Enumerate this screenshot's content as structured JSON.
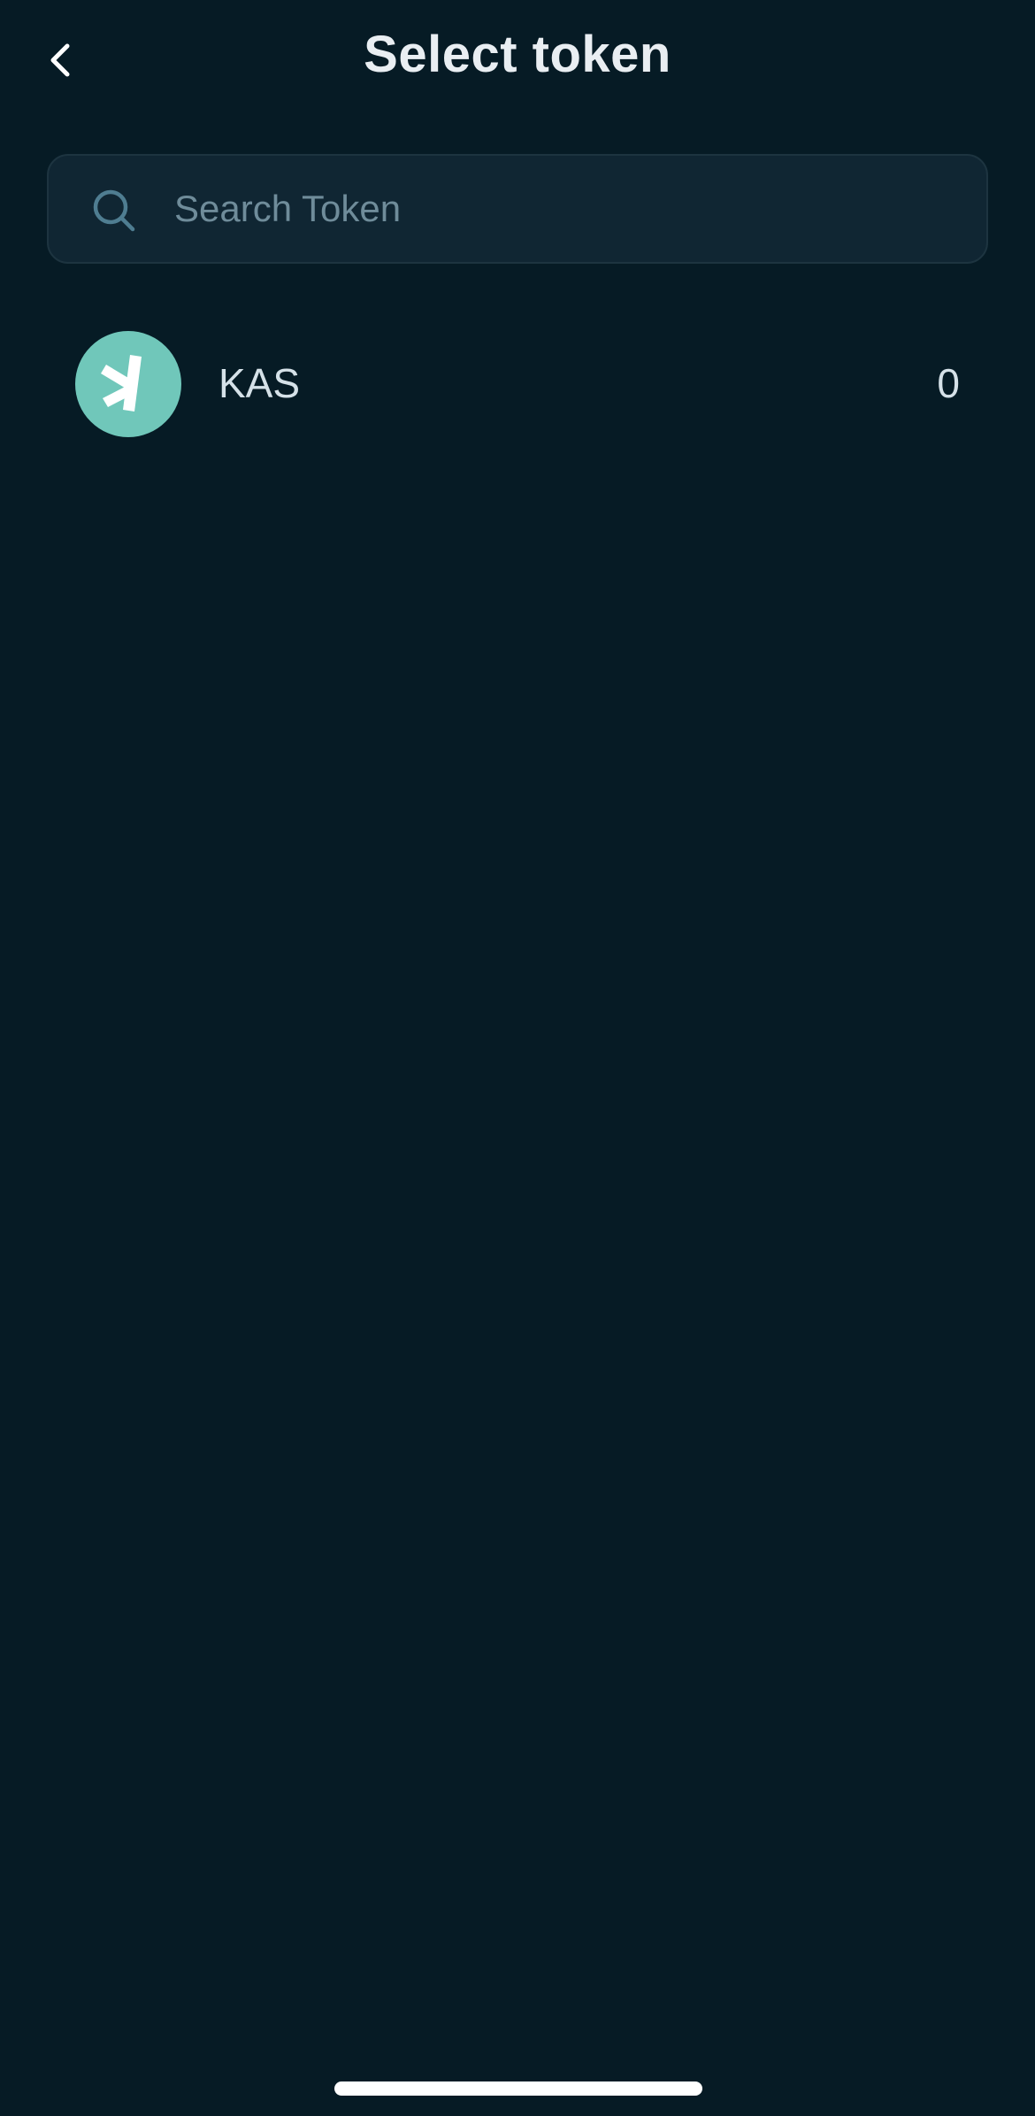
{
  "header": {
    "title": "Select token",
    "back_icon": "chevron-left-icon"
  },
  "search": {
    "placeholder": "Search Token",
    "value": "",
    "icon": "search-icon"
  },
  "tokens": [
    {
      "name": "KAS",
      "balance": "0",
      "logo_icon": "kaspa-logo-icon",
      "logo_color": "#70c7ba"
    }
  ],
  "colors": {
    "background": "#061b25",
    "search_background": "#102633",
    "accent": "#70c7ba"
  }
}
